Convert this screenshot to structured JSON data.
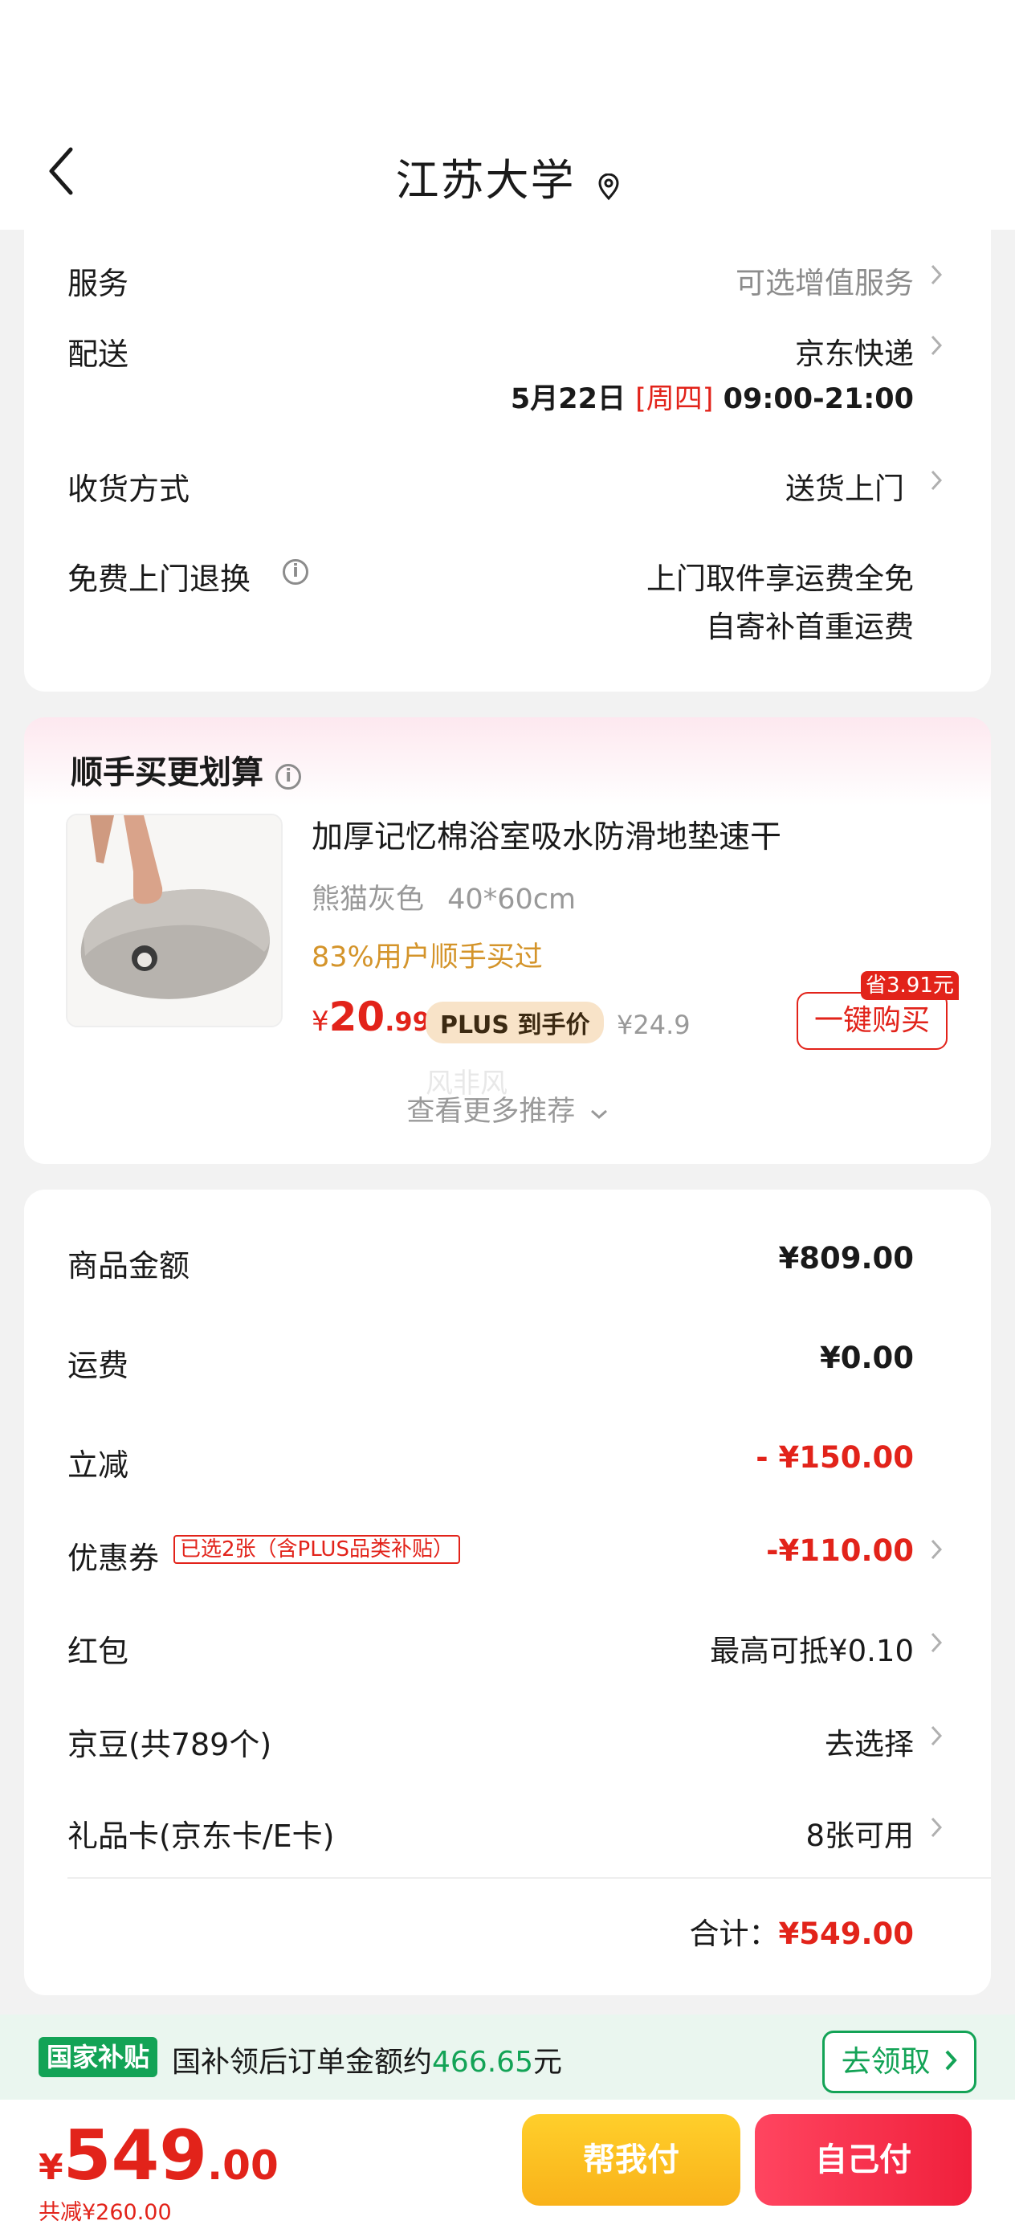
{
  "header": {
    "title": "江苏大学",
    "back_icon": "chevron-left-icon",
    "location_icon": "location-pin-icon"
  },
  "service_card": {
    "service": {
      "label": "服务",
      "value": "可选增值服务"
    },
    "delivery": {
      "label": "配送",
      "value": "京东快递",
      "date": "5月22日",
      "weekday": "[周四]",
      "time": "09:00-21:00"
    },
    "receive": {
      "label": "收货方式",
      "value": "送货上门"
    },
    "free_return": {
      "label": "免费上门退换",
      "line1": "上门取件享运费全免",
      "line2": "自寄补首重运费"
    }
  },
  "recommend": {
    "title": "顺手买更划算",
    "product": {
      "name": "加厚记忆棉浴室吸水防滑地垫速干",
      "color": "熊猫灰色",
      "size": "40*60cm",
      "hint": "83%用户顺手买过",
      "currency": "¥",
      "price_int": "20",
      "price_dec": ".99",
      "plus_label": "PLUS 到手价",
      "old_price": "¥24.9",
      "save_tag": "省3.91元",
      "buy_label": "一键购买"
    },
    "more_label": "查看更多推荐",
    "watermark": "风非风"
  },
  "totals": {
    "goods": {
      "label": "商品金额",
      "value": "¥809.00"
    },
    "freight": {
      "label": "运费",
      "value": "¥0.00"
    },
    "discount": {
      "label": "立减",
      "value": "- ¥150.00"
    },
    "coupon": {
      "label": "优惠券",
      "badge": "已选2张（含PLUS品类补贴）",
      "value": "-¥110.00"
    },
    "red_packet": {
      "label": "红包",
      "value": "最高可抵¥0.10"
    },
    "beans": {
      "label": "京豆(共789个)",
      "value": "去选择"
    },
    "gift_card": {
      "label": "礼品卡(京东卡/E卡)",
      "value": "8张可用"
    },
    "sum": {
      "label": "合计：",
      "value": "¥549.00"
    }
  },
  "subsidy": {
    "badge": "国家补贴",
    "text": "国补领后订单金额约",
    "amount": "466.65",
    "unit": "元",
    "button": "去领取"
  },
  "bottom_bar": {
    "currency": "¥",
    "price_int": "549",
    "price_dec": ".00",
    "saved": "共减¥260.00",
    "help_pay": "帮我付",
    "self_pay": "自己付"
  },
  "colors": {
    "accent_red": "#e2231a",
    "subsidy_green": "#13a356",
    "help_yellow": "#f9b21a",
    "pay_red": "#f0203c"
  }
}
